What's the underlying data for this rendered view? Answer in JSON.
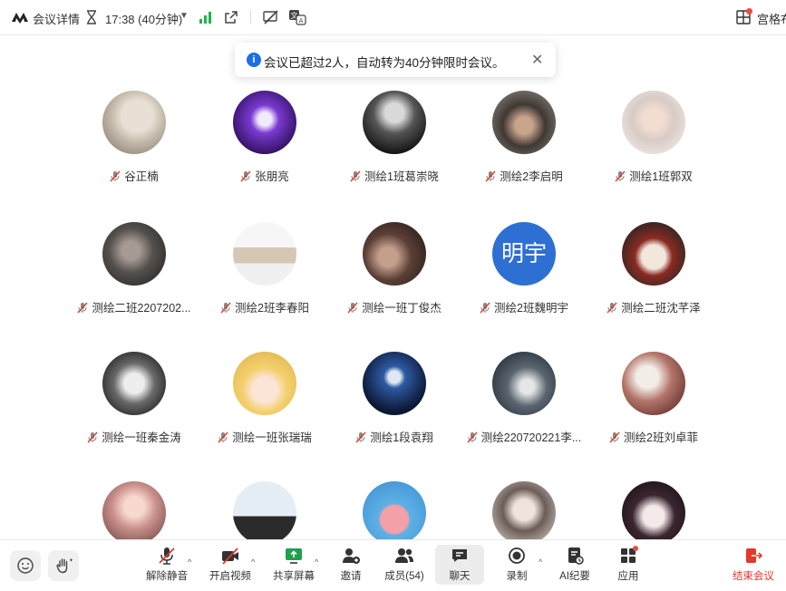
{
  "topbar": {
    "title": "会议详情",
    "timer": "17:38 (40分钟)",
    "layout_label": "宫格布"
  },
  "notice": {
    "text": "会议已超过2人，自动转为40分钟限时会议。",
    "info_glyph": "i",
    "close_glyph": "✕"
  },
  "participants": [
    {
      "name": "谷正楠",
      "avatar": "photo-landscape"
    },
    {
      "name": "张朋亮",
      "avatar": "photo-purple-bunny"
    },
    {
      "name": "测绘1班葛崇晓",
      "avatar": "photo-dark-hair"
    },
    {
      "name": "测绘2李启明",
      "avatar": "photo-person-hands"
    },
    {
      "name": "测绘1班郭双",
      "avatar": "photo-child"
    },
    {
      "name": "测绘二班2207202...",
      "avatar": "photo-girl-bw"
    },
    {
      "name": "测绘2班李春阳",
      "avatar": "photo-screenshot"
    },
    {
      "name": "测绘一班丁俊杰",
      "avatar": "photo-couple"
    },
    {
      "name": "测绘2班魏明宇",
      "avatar": "text",
      "avatar_text": "明宇",
      "avatar_color": "#2e6fd3"
    },
    {
      "name": "测绘二班沈芊泽",
      "avatar": "photo-cartoon-face"
    },
    {
      "name": "测绘一班秦金涛",
      "avatar": "photo-cat"
    },
    {
      "name": "测绘一班张瑞瑞",
      "avatar": "photo-anime-blond"
    },
    {
      "name": "测绘1段袁翔",
      "avatar": "photo-moon"
    },
    {
      "name": "测绘220720221李...",
      "avatar": "photo-person-sea"
    },
    {
      "name": "测绘2班刘卓菲",
      "avatar": "photo-woman-room"
    },
    {
      "name": "",
      "avatar": "photo-sunset-girl"
    },
    {
      "name": "",
      "avatar": "photo-screen-sky"
    },
    {
      "name": "",
      "avatar": "photo-patrick"
    },
    {
      "name": "",
      "avatar": "photo-girl-portrait"
    },
    {
      "name": "",
      "avatar": "photo-anime-dark"
    }
  ],
  "toolbar": {
    "unmute": "解除静音",
    "start_video": "开启视频",
    "share_screen": "共享屏幕",
    "invite": "邀请",
    "members": "成员(54)",
    "chat": "聊天",
    "record": "录制",
    "ai_summary": "AI纪要",
    "apps": "应用",
    "end_meeting": "结束会议",
    "caret": "^"
  },
  "colors": {
    "accent_blue": "#1b6fe6",
    "signal_green": "#1fb34a",
    "end_red": "#e03a2a",
    "badge_red": "#f04a3e"
  }
}
